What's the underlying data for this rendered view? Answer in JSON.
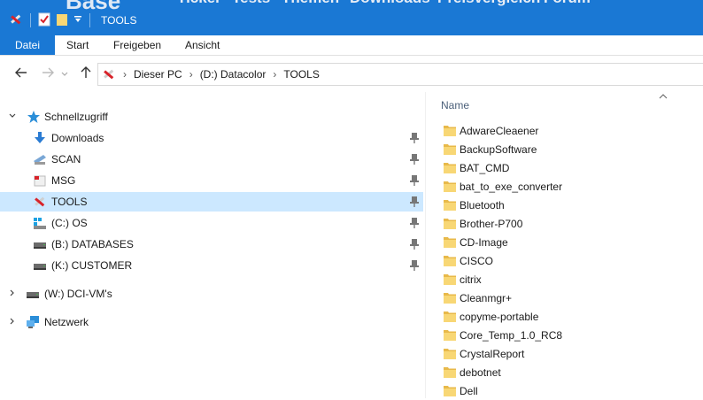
{
  "background_site": {
    "logo": "Base",
    "nav": [
      "Ticker",
      "Tests",
      "Themen",
      "Downloads",
      "Preisvergleich",
      "Forum"
    ]
  },
  "window": {
    "title": "TOOLS"
  },
  "ribbon": {
    "tabs": [
      "Datei",
      "Start",
      "Freigeben",
      "Ansicht"
    ]
  },
  "address": {
    "crumbs": [
      "Dieser PC",
      "(D:) Datacolor",
      "TOOLS"
    ]
  },
  "tree": {
    "quick_access": "Schnellzugriff",
    "pinned": [
      {
        "label": "Downloads",
        "icon": "download-arrow-icon"
      },
      {
        "label": "SCAN",
        "icon": "scanner-icon"
      },
      {
        "label": "MSG",
        "icon": "message-icon"
      },
      {
        "label": "TOOLS",
        "icon": "tools-icon",
        "selected": true
      },
      {
        "label": "(C:) OS",
        "icon": "windows-drive-icon"
      },
      {
        "label": "(B:) DATABASES",
        "icon": "network-drive-icon"
      },
      {
        "label": "(K:) CUSTOMER",
        "icon": "network-drive-icon"
      }
    ],
    "network_drive": "(W:) DCI-VM's",
    "network": "Netzwerk"
  },
  "files": {
    "column_name": "Name",
    "items": [
      "AdwareCleaener",
      "BackupSoftware",
      "BAT_CMD",
      "bat_to_exe_converter",
      "Bluetooth",
      "Brother-P700",
      "CD-Image",
      "CISCO",
      "citrix",
      "Cleanmgr+",
      "copyme-portable",
      "Core_Temp_1.0_RC8",
      "CrystalReport",
      "debotnet",
      "Dell"
    ]
  },
  "colors": {
    "accent": "#1a78d4",
    "selection": "#cce8ff",
    "folder": "#f8d775"
  }
}
